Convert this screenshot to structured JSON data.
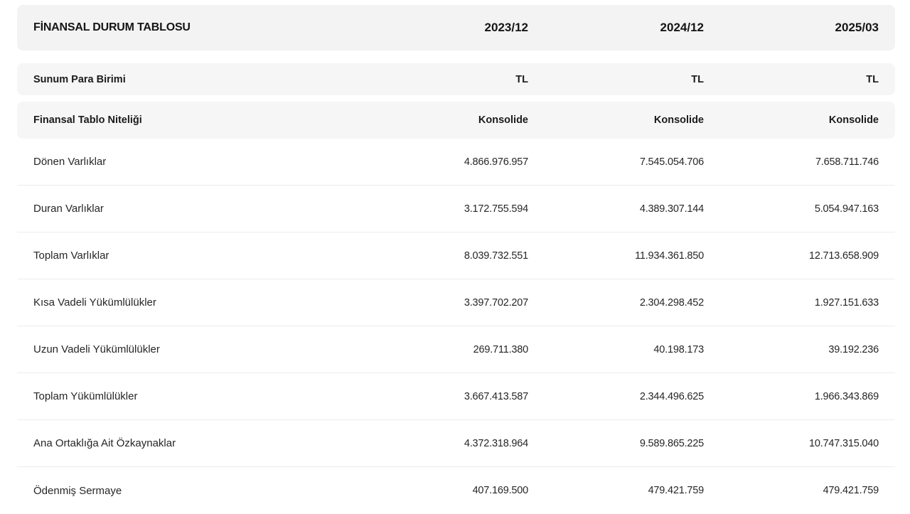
{
  "header": {
    "title": "FİNANSAL DURUM TABLOSU",
    "periods": [
      "2023/12",
      "2024/12",
      "2025/03"
    ]
  },
  "meta": [
    {
      "label": "Sunum Para Birimi",
      "values": [
        "TL",
        "TL",
        "TL"
      ]
    },
    {
      "label": "Finansal Tablo Niteliği",
      "values": [
        "Konsolide",
        "Konsolide",
        "Konsolide"
      ]
    }
  ],
  "rows": [
    {
      "label": "Dönen Varlıklar",
      "values": [
        "4.866.976.957",
        "7.545.054.706",
        "7.658.711.746"
      ]
    },
    {
      "label": "Duran Varlıklar",
      "values": [
        "3.172.755.594",
        "4.389.307.144",
        "5.054.947.163"
      ]
    },
    {
      "label": "Toplam Varlıklar",
      "values": [
        "8.039.732.551",
        "11.934.361.850",
        "12.713.658.909"
      ]
    },
    {
      "label": "Kısa Vadeli Yükümlülükler",
      "values": [
        "3.397.702.207",
        "2.304.298.452",
        "1.927.151.633"
      ]
    },
    {
      "label": "Uzun Vadeli Yükümlülükler",
      "values": [
        "269.711.380",
        "40.198.173",
        "39.192.236"
      ]
    },
    {
      "label": "Toplam Yükümlülükler",
      "values": [
        "3.667.413.587",
        "2.344.496.625",
        "1.966.343.869"
      ]
    },
    {
      "label": "Ana Ortaklığa Ait Özkaynaklar",
      "values": [
        "4.372.318.964",
        "9.589.865.225",
        "10.747.315.040"
      ]
    },
    {
      "label": "Ödenmiş Sermaye",
      "values": [
        "407.169.500",
        "479.421.759",
        "479.421.759"
      ]
    }
  ]
}
